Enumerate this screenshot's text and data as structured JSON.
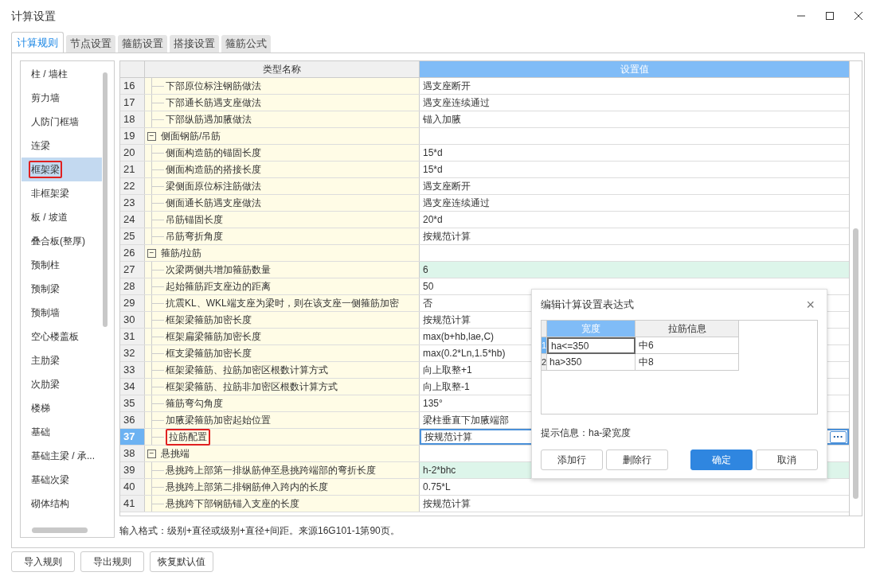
{
  "window": {
    "title": "计算设置"
  },
  "tabs": [
    {
      "label": "计算规则",
      "selected": true
    },
    {
      "label": "节点设置",
      "selected": false
    },
    {
      "label": "箍筋设置",
      "selected": false
    },
    {
      "label": "搭接设置",
      "selected": false
    },
    {
      "label": "箍筋公式",
      "selected": false
    }
  ],
  "sidebar": {
    "items": [
      {
        "label": "柱 / 墙柱",
        "selected": false,
        "annotated": false
      },
      {
        "label": "剪力墙",
        "selected": false,
        "annotated": false
      },
      {
        "label": "人防门框墙",
        "selected": false,
        "annotated": false
      },
      {
        "label": "连梁",
        "selected": false,
        "annotated": false
      },
      {
        "label": "框架梁",
        "selected": true,
        "annotated": true
      },
      {
        "label": "非框架梁",
        "selected": false,
        "annotated": false
      },
      {
        "label": "板 / 坡道",
        "selected": false,
        "annotated": false
      },
      {
        "label": "叠合板(整厚)",
        "selected": false,
        "annotated": false
      },
      {
        "label": "预制柱",
        "selected": false,
        "annotated": false
      },
      {
        "label": "预制梁",
        "selected": false,
        "annotated": false
      },
      {
        "label": "预制墙",
        "selected": false,
        "annotated": false
      },
      {
        "label": "空心楼盖板",
        "selected": false,
        "annotated": false
      },
      {
        "label": "主肋梁",
        "selected": false,
        "annotated": false
      },
      {
        "label": "次肋梁",
        "selected": false,
        "annotated": false
      },
      {
        "label": "楼梯",
        "selected": false,
        "annotated": false
      },
      {
        "label": "基础",
        "selected": false,
        "annotated": false
      },
      {
        "label": "基础主梁 / 承...",
        "selected": false,
        "annotated": false
      },
      {
        "label": "基础次梁",
        "selected": false,
        "annotated": false
      },
      {
        "label": "砌体结构",
        "selected": false,
        "annotated": false
      }
    ]
  },
  "table": {
    "columns": [
      "类型名称",
      "设置值"
    ],
    "rows": [
      {
        "kind": "item",
        "number": "16",
        "name": "下部原位标注钢筋做法",
        "value": "遇支座断开",
        "selected": false,
        "tinted": false,
        "annotated": false
      },
      {
        "kind": "item",
        "number": "17",
        "name": "下部通长筋遇支座做法",
        "value": "遇支座连续通过",
        "selected": false,
        "tinted": false,
        "annotated": false
      },
      {
        "kind": "item",
        "number": "18",
        "name": "下部纵筋遇加腋做法",
        "value": "锚入加腋",
        "selected": false,
        "tinted": false,
        "annotated": false
      },
      {
        "kind": "group",
        "number": "19",
        "toggle": "−",
        "name": "侧面钢筋/吊筋",
        "expanded": true,
        "selected": false
      },
      {
        "kind": "item",
        "number": "20",
        "name": "侧面构造筋的锚固长度",
        "value": "15*d",
        "selected": false,
        "tinted": false,
        "annotated": false
      },
      {
        "kind": "item",
        "number": "21",
        "name": "侧面构造筋的搭接长度",
        "value": "15*d",
        "selected": false,
        "tinted": false,
        "annotated": false
      },
      {
        "kind": "item",
        "number": "22",
        "name": "梁侧面原位标注筋做法",
        "value": "遇支座断开",
        "selected": false,
        "tinted": false,
        "annotated": false
      },
      {
        "kind": "item",
        "number": "23",
        "name": "侧面通长筋遇支座做法",
        "value": "遇支座连续通过",
        "selected": false,
        "tinted": false,
        "annotated": false
      },
      {
        "kind": "item",
        "number": "24",
        "name": "吊筋锚固长度",
        "value": "20*d",
        "selected": false,
        "tinted": false,
        "annotated": false
      },
      {
        "kind": "item",
        "number": "25",
        "name": "吊筋弯折角度",
        "value": "按规范计算",
        "selected": false,
        "tinted": false,
        "annotated": false
      },
      {
        "kind": "group",
        "number": "26",
        "toggle": "−",
        "name": "箍筋/拉筋",
        "expanded": true,
        "selected": false
      },
      {
        "kind": "item",
        "number": "27",
        "name": "次梁两侧共增加箍筋数量",
        "value": "6",
        "selected": false,
        "tinted": true,
        "annotated": false
      },
      {
        "kind": "item",
        "number": "28",
        "name": "起始箍筋距支座边的距离",
        "value": "50",
        "selected": false,
        "tinted": false,
        "annotated": false
      },
      {
        "kind": "item",
        "number": "29",
        "name": "抗震KL、WKL端支座为梁时，则在该支座一侧箍筋加密",
        "value": "否",
        "selected": false,
        "tinted": false,
        "annotated": false
      },
      {
        "kind": "item",
        "number": "30",
        "name": "框架梁箍筋加密长度",
        "value": "按规范计算",
        "selected": false,
        "tinted": false,
        "annotated": false
      },
      {
        "kind": "item",
        "number": "31",
        "name": "框架扁梁箍筋加密长度",
        "value": "max(b+hb,lae,C)",
        "selected": false,
        "tinted": false,
        "annotated": false
      },
      {
        "kind": "item",
        "number": "32",
        "name": "框支梁箍筋加密长度",
        "value": "max(0.2*Ln,1.5*hb)",
        "selected": false,
        "tinted": false,
        "annotated": false
      },
      {
        "kind": "item",
        "number": "33",
        "name": "框架梁箍筋、拉筋加密区根数计算方式",
        "value": "向上取整+1",
        "selected": false,
        "tinted": false,
        "annotated": false
      },
      {
        "kind": "item",
        "number": "34",
        "name": "框架梁箍筋、拉筋非加密区根数计算方式",
        "value": "向上取整-1",
        "selected": false,
        "tinted": false,
        "annotated": false
      },
      {
        "kind": "item",
        "number": "35",
        "name": "箍筋弯勾角度",
        "value": "135°",
        "selected": false,
        "tinted": false,
        "annotated": false
      },
      {
        "kind": "item",
        "number": "36",
        "name": "加腋梁箍筋加密起始位置",
        "value": "梁柱垂直下加腋端部",
        "selected": false,
        "tinted": false,
        "annotated": false
      },
      {
        "kind": "item",
        "number": "37",
        "name": "拉筋配置",
        "value": "按规范计算",
        "edit_button": "···",
        "selected": true,
        "tinted": false,
        "annotated": true
      },
      {
        "kind": "group",
        "number": "38",
        "toggle": "−",
        "name": "悬挑端",
        "expanded": true,
        "selected": false
      },
      {
        "kind": "item",
        "number": "39",
        "name": "悬挑跨上部第一排纵筋伸至悬挑跨端部的弯折长度",
        "value": "h-2*bhc",
        "selected": false,
        "tinted": true,
        "annotated": false
      },
      {
        "kind": "item",
        "number": "40",
        "name": "悬挑跨上部第二排钢筋伸入跨内的长度",
        "value": "0.75*L",
        "selected": false,
        "tinted": false,
        "annotated": false
      },
      {
        "kind": "item",
        "number": "41",
        "name": "悬挑跨下部钢筋锚入支座的长度",
        "value": "按规范计算",
        "selected": false,
        "tinted": false,
        "annotated": false
      }
    ]
  },
  "hint": "输入格式：级别+直径或级别+直径+间距。来源16G101-1第90页。",
  "buttons": [
    "导入规则",
    "导出规则",
    "恢复默认值"
  ],
  "dialog": {
    "title": "编辑计算设置表达式",
    "close": "×",
    "columns": [
      {
        "label": "宽度",
        "selected": true
      },
      {
        "label": "拉筋信息",
        "selected": false
      }
    ],
    "rows": [
      {
        "number": "1",
        "width": "ha<=350",
        "info": "中6",
        "selected": true
      },
      {
        "number": "2",
        "width": "ha>350",
        "info": "中8",
        "selected": false
      }
    ],
    "hint": "提示信息：ha-梁宽度",
    "buttons": [
      {
        "label": "添加行",
        "primary": false
      },
      {
        "label": "删除行",
        "primary": false
      },
      {
        "label": "确定",
        "primary": true
      },
      {
        "label": "取消",
        "primary": false
      }
    ]
  }
}
